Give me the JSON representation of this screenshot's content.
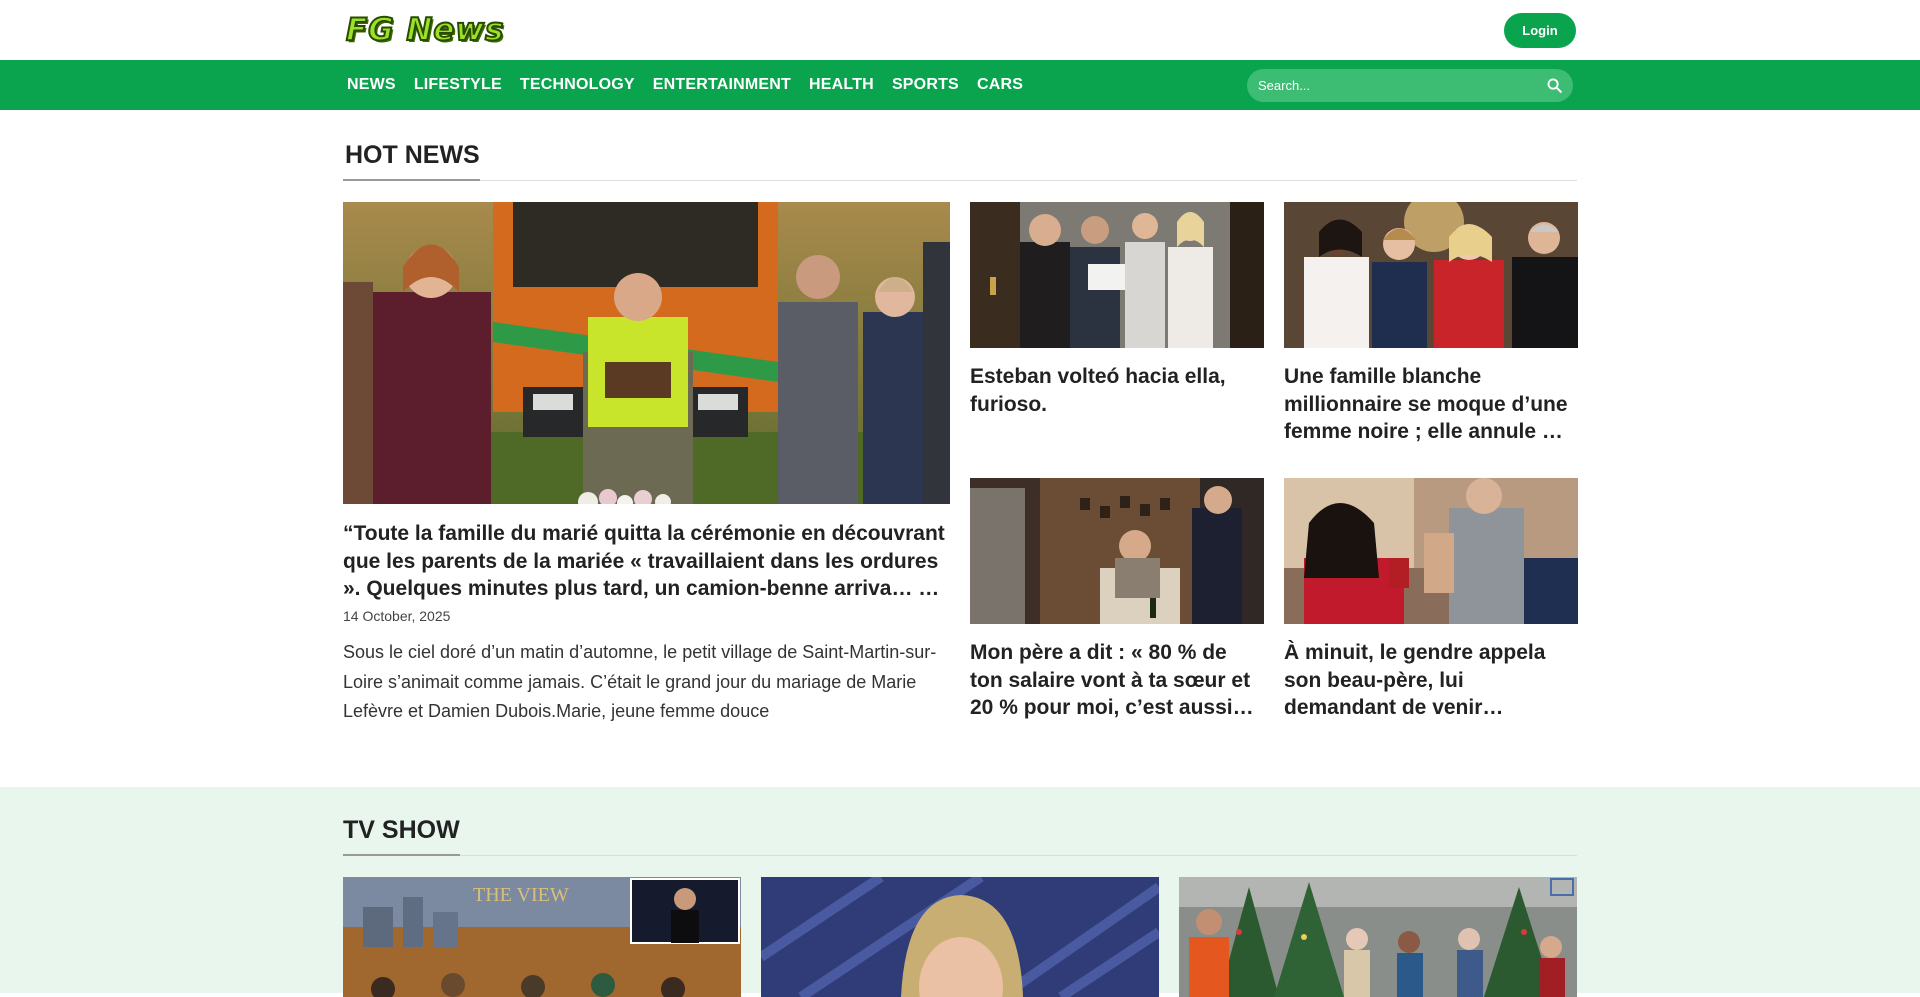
{
  "site": {
    "logo_text": "FG News",
    "login_label": "Login"
  },
  "nav": {
    "items": [
      "NEWS",
      "LIFESTYLE",
      "TECHNOLOGY",
      "ENTERTAINMENT",
      "HEALTH",
      "SPORTS",
      "CARS"
    ],
    "search_placeholder": "Search..."
  },
  "hot_news": {
    "heading": "HOT NEWS",
    "main": {
      "title": "“Toute la famille du marié quitta la cérémonie en découvrant que les parents de la mariée « travaillaient dans les ordures ». Quelques minutes plus tard, un camion-benne arriva… …",
      "date": "14 October, 2025",
      "excerpt": "Sous le ciel doré d’un matin d’automne, le petit village de Saint-Martin-sur-Loire s’animait comme jamais. C’était le grand jour du mariage de Marie Lefèvre et Damien Dubois.Marie, jeune femme douce"
    },
    "side": [
      {
        "title": "Esteban volteó hacia ella, furioso."
      },
      {
        "title": "Une famille blanche millionnaire se moque d’une femme noire ; elle annule …"
      },
      {
        "title": "Mon père a dit : « 80 % de ton salaire vont à ta sœur et 20 % pour moi, c’est aussi…"
      },
      {
        "title": "À minuit, le gendre appela son beau-père, lui demandant de venir…"
      }
    ]
  },
  "tv_show": {
    "heading": "TV SHOW",
    "card1_logo_text": "THE VIEW"
  },
  "colors": {
    "brand_green": "#0aa44f",
    "tv_bg": "#e8f6ee"
  }
}
